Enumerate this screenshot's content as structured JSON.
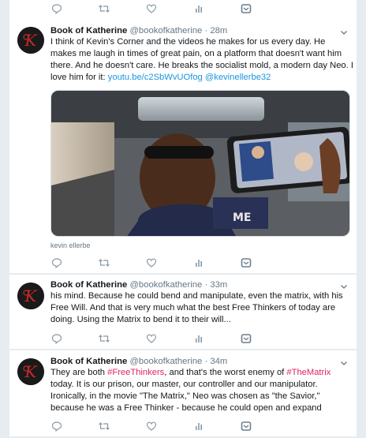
{
  "author": {
    "name": "Book of Katherine",
    "handle": "@bookofkatherine",
    "separator": "·"
  },
  "tweets": [
    {
      "time": "28m",
      "text_parts": [
        "I think of Kevin's Corner and the videos he makes for us every day. He makes me laugh in times of great pain, on a platform that doesn't want him there. And he doesn't care. He breaks the socialist mold, a modern day Neo. I love him for it: ",
        "youtu.be/c2SbWvUOfog",
        " ",
        "@kevinellerbe32"
      ],
      "media_tag": "kevin ellerbe"
    },
    {
      "time": "33m",
      "text": "his mind. Because he could bend and manipulate, even the matrix, with his Free Will. And that is very much what the best Free Thinkers of today are doing. Using the Matrix to bend it to their will..."
    },
    {
      "time": "34m",
      "text_parts": [
        "They are both ",
        "#FreeThinkers",
        ", and that's the worst enemy of ",
        "#TheMatrix",
        " today. It is our prison, our master, our controller and our manipulator. Ironically, in the movie \"The Matrix,\" Neo was chosen as \"the Savior,\" because he was a Free Thinker - because he could open and expand"
      ]
    }
  ],
  "icons": [
    "reply-icon",
    "retweet-icon",
    "like-icon",
    "analytics-icon",
    "dm-icon",
    "caret-down-icon"
  ],
  "colors": {
    "background": "#e6ecf0",
    "link": "#1b95e0",
    "hashtag": "#e0245e",
    "muted": "#657786"
  }
}
